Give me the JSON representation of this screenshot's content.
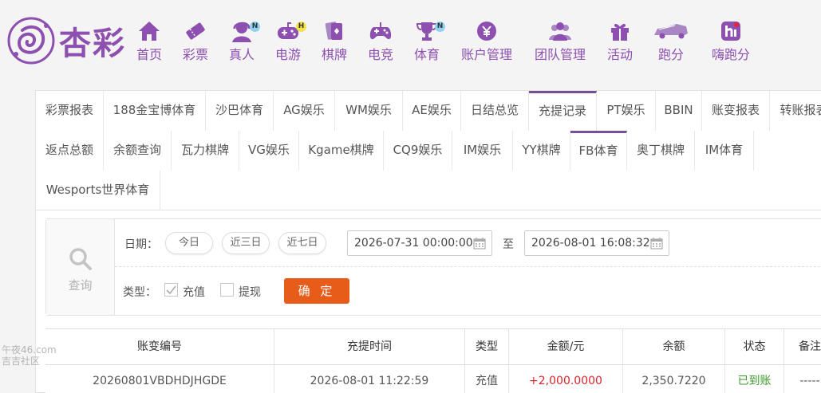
{
  "brand": {
    "name": "杏彩",
    "color": "#8d4fb0"
  },
  "nav": [
    {
      "label": "首页",
      "icon": "home-icon"
    },
    {
      "label": "彩票",
      "icon": "lottery-ticket-icon"
    },
    {
      "label": "真人",
      "icon": "live-dealer-icon",
      "badge": "N"
    },
    {
      "label": "电游",
      "icon": "gamepad-icon",
      "badge": "H"
    },
    {
      "label": "棋牌",
      "icon": "cards-icon"
    },
    {
      "label": "电竞",
      "icon": "controller-icon"
    },
    {
      "label": "体育",
      "icon": "trophy-icon",
      "badge": "N"
    },
    {
      "label": "账户管理",
      "icon": "yen-coin-icon"
    },
    {
      "label": "团队管理",
      "icon": "team-icon"
    },
    {
      "label": "活动",
      "icon": "gift-icon"
    },
    {
      "label": "跑分",
      "icon": "race-car-icon"
    },
    {
      "label": "嗨跑分",
      "icon": "hi-app-icon"
    }
  ],
  "tabs_row1": [
    "彩票报表",
    "188金宝博体育",
    "沙巴体育",
    "AG娱乐",
    "WM娱乐",
    "AE娱乐",
    "日结总览",
    "充提记录",
    "PT娱乐",
    "BBIN",
    "账变报表",
    "转账报表"
  ],
  "tabs_row2": [
    "返点总额",
    "余额查询",
    "瓦力棋牌",
    "VG娱乐",
    "Kgame棋牌",
    "CQ9娱乐",
    "IM娱乐",
    "YY棋牌",
    "FB体育",
    "奥丁棋牌",
    "IM体育"
  ],
  "tabs_row3": [
    "Wesports世界体育"
  ],
  "active_tabs": [
    "充提记录",
    "FB体育"
  ],
  "filter": {
    "query_label": "查询",
    "date_label": "日期：",
    "quick_dates": [
      "今日",
      "近三日",
      "近七日"
    ],
    "start": "2026-07-31 00:00:00",
    "to": "至",
    "end": "2026-08-01 16:08:32",
    "type_label": "类型：",
    "types": [
      {
        "label": "充值",
        "checked": true
      },
      {
        "label": "提现",
        "checked": false
      }
    ],
    "submit": "确 定"
  },
  "table": {
    "headers": [
      "账变编号",
      "充提时间",
      "类型",
      "金额/元",
      "余额",
      "状态",
      "备注"
    ],
    "rows": [
      [
        "20260801VBDHDJHGDE",
        "2026-08-01 11:22:59",
        "充值",
        "+2,000.0000",
        "2,350.7220",
        "已到账",
        "-----"
      ]
    ]
  },
  "watermark": [
    "午夜46.com",
    "吉吉社区"
  ]
}
